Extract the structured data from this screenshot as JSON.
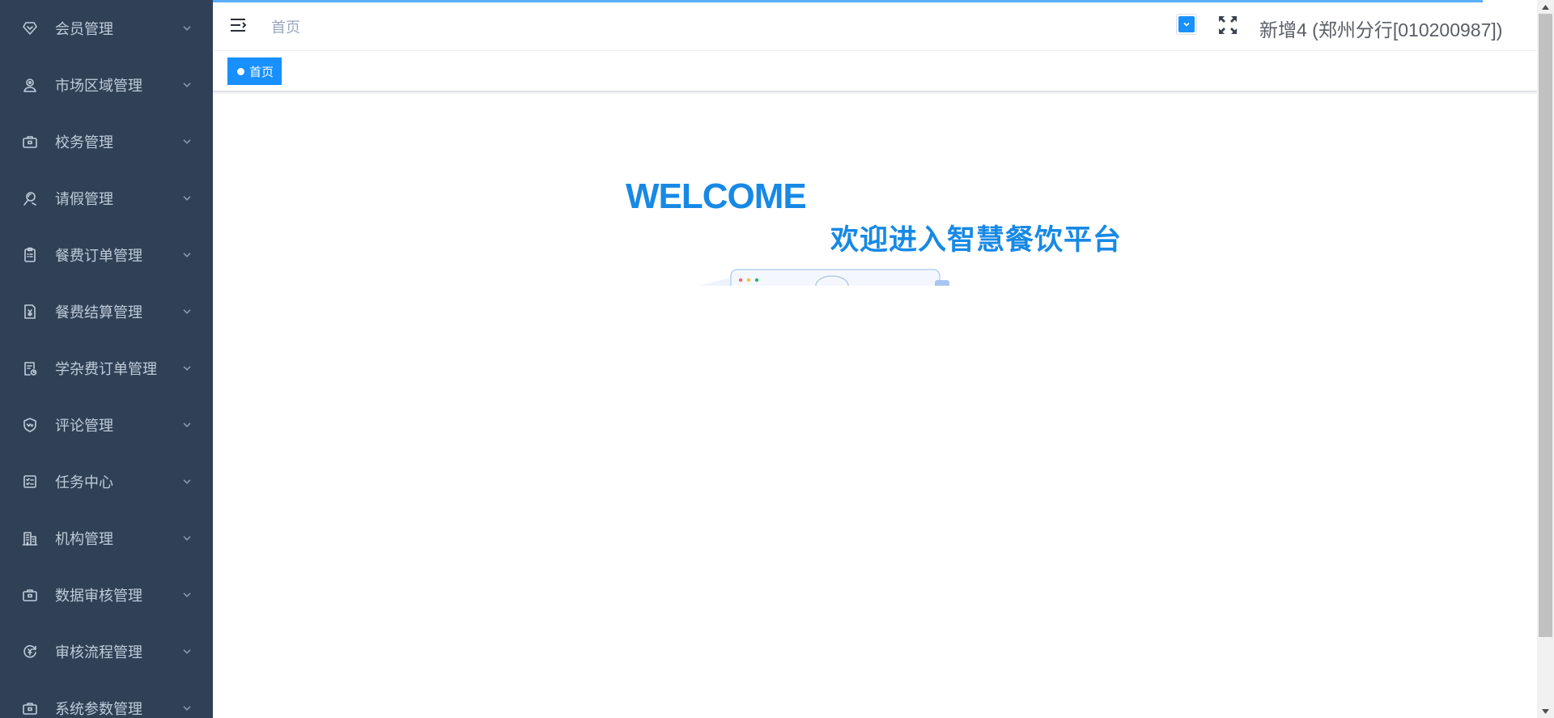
{
  "sidebar": {
    "items": [
      {
        "label": "会员管理",
        "icon": "member-icon"
      },
      {
        "label": "市场区域管理",
        "icon": "market-area-icon"
      },
      {
        "label": "校务管理",
        "icon": "briefcase-icon"
      },
      {
        "label": "请假管理",
        "icon": "leave-icon"
      },
      {
        "label": "餐费订单管理",
        "icon": "clipboard-icon"
      },
      {
        "label": "餐费结算管理",
        "icon": "settlement-icon"
      },
      {
        "label": "学杂费订单管理",
        "icon": "fee-order-icon"
      },
      {
        "label": "评论管理",
        "icon": "comment-shield-icon"
      },
      {
        "label": "任务中心",
        "icon": "task-list-icon"
      },
      {
        "label": "机构管理",
        "icon": "building-icon"
      },
      {
        "label": "数据审核管理",
        "icon": "briefcase-icon"
      },
      {
        "label": "审核流程管理",
        "icon": "process-icon"
      },
      {
        "label": "系统参数管理",
        "icon": "briefcase-icon"
      }
    ]
  },
  "navbar": {
    "breadcrumb": "首页",
    "user": "新增4 (郑州分行[010200987])"
  },
  "tags": {
    "active": "首页"
  },
  "welcome": {
    "title": "WELCOME",
    "subtitle": "欢迎进入智慧餐饮平台"
  },
  "colors": {
    "sidebar_bg": "#304156",
    "accent": "#1890ff",
    "welcome_text": "#1789e5"
  }
}
